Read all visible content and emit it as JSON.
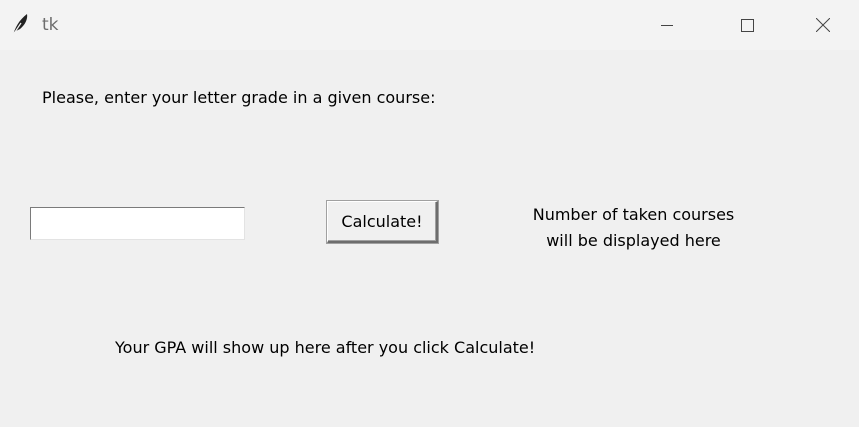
{
  "window": {
    "title": "tk",
    "icon": "feather-icon",
    "controls": [
      "minimize-icon",
      "maximize-icon",
      "close-icon"
    ]
  },
  "content": {
    "prompt_label": "Please, enter your letter grade in a given course:",
    "grade_entry": {
      "value": "",
      "placeholder": ""
    },
    "calculate_button": "Calculate!",
    "courses_label": {
      "line1": "Number of taken courses",
      "line2": "will be displayed here"
    },
    "gpa_label": "Your GPA will show up here after you click Calculate!"
  }
}
